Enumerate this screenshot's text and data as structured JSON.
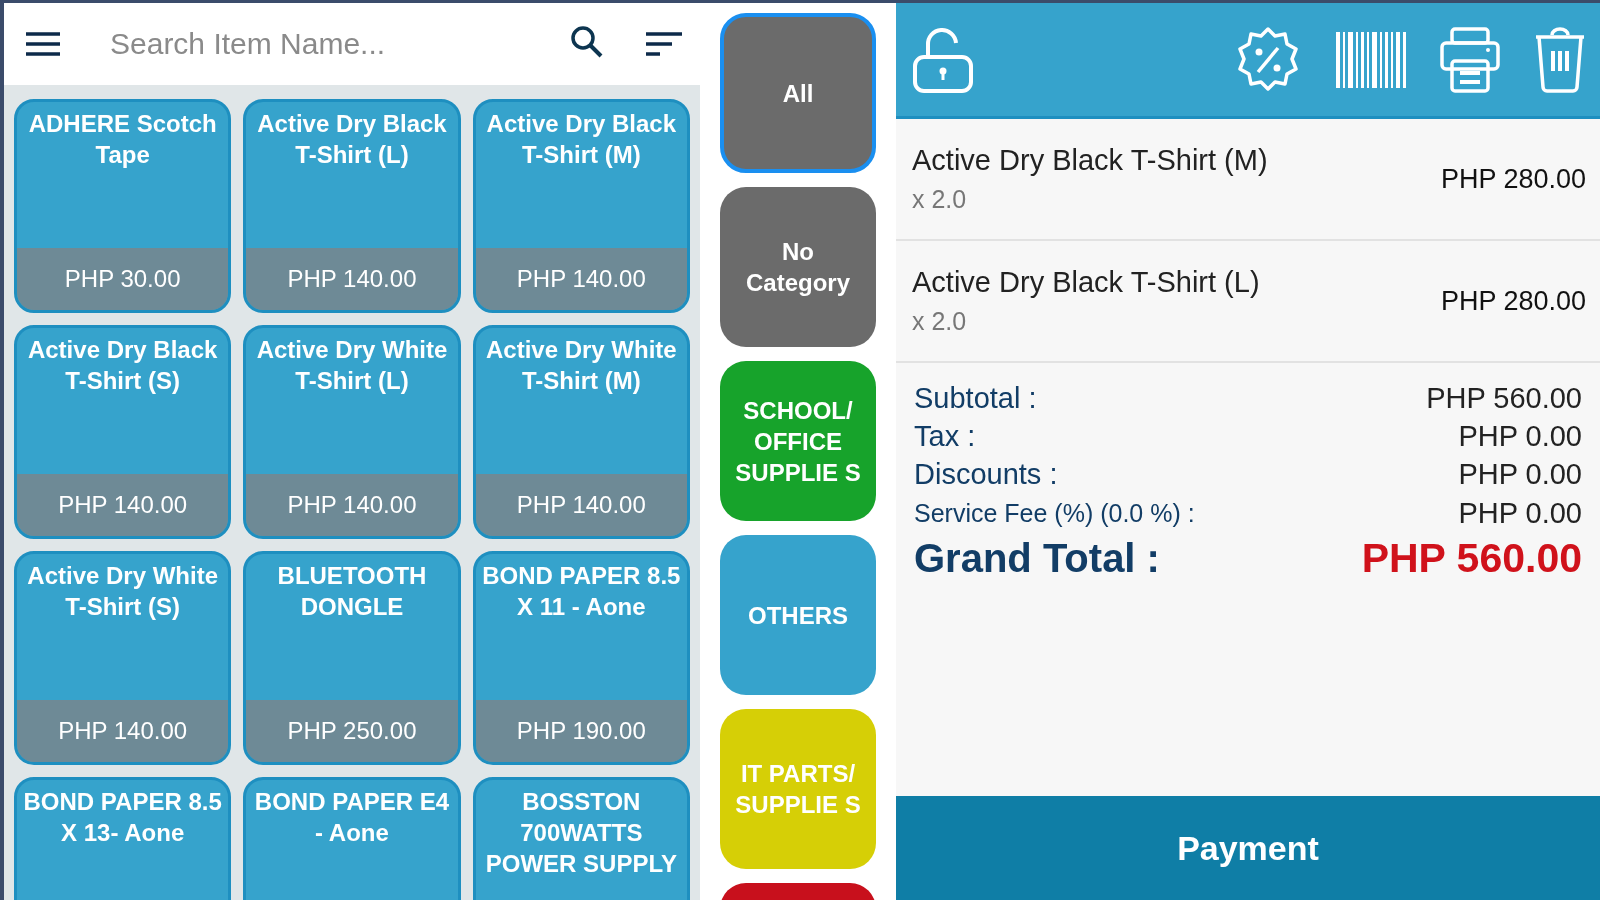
{
  "search": {
    "placeholder": "Search Item Name..."
  },
  "items": [
    {
      "name": "ADHERE Scotch Tape",
      "price": "PHP 30.00"
    },
    {
      "name": "Active Dry Black T-Shirt (L)",
      "price": "PHP 140.00"
    },
    {
      "name": "Active Dry Black T-Shirt (M)",
      "price": "PHP 140.00"
    },
    {
      "name": "Active Dry Black T-Shirt (S)",
      "price": "PHP 140.00"
    },
    {
      "name": "Active Dry White T-Shirt (L)",
      "price": "PHP 140.00"
    },
    {
      "name": "Active Dry White T-Shirt (M)",
      "price": "PHP 140.00"
    },
    {
      "name": "Active Dry White T-Shirt (S)",
      "price": "PHP 140.00"
    },
    {
      "name": "BLUETOOTH DONGLE",
      "price": "PHP 250.00"
    },
    {
      "name": "BOND PAPER 8.5 X 11 - Aone",
      "price": "PHP 190.00"
    },
    {
      "name": "BOND PAPER 8.5 X 13- Aone"
    },
    {
      "name": "BOND PAPER E4 - Aone"
    },
    {
      "name": "BOSSTON 700WATTS POWER SUPPLY"
    }
  ],
  "categories": [
    {
      "label": "All",
      "color": "#6b6b6b",
      "selected": true
    },
    {
      "label": "No Category",
      "color": "#6b6b6b",
      "selected": false
    },
    {
      "label": "SCHOOL/ OFFICE SUPPLIE S",
      "color": "#17a32b",
      "selected": false
    },
    {
      "label": "OTHERS",
      "color": "#36a3cc",
      "selected": false
    },
    {
      "label": "IT PARTS/ SUPPLIE S",
      "color": "#d6cf06",
      "selected": false
    },
    {
      "color": "#c8101c",
      "selected": false
    }
  ],
  "cart": [
    {
      "name": "Active Dry Black T-Shirt (M)",
      "qty": "x 2.0",
      "amount": "PHP 280.00"
    },
    {
      "name": "Active Dry Black T-Shirt (L)",
      "qty": "x 2.0",
      "amount": "PHP 280.00"
    }
  ],
  "totals": [
    {
      "kind": "line",
      "label": "Subtotal :",
      "value": "PHP 560.00"
    },
    {
      "kind": "line",
      "label": "Tax :",
      "value": "PHP 0.00"
    },
    {
      "kind": "line",
      "label": "Discounts :",
      "value": "PHP 0.00"
    },
    {
      "kind": "small",
      "label": "Service Fee (%) (0.0 %) :",
      "value": "PHP 0.00"
    },
    {
      "kind": "grand",
      "label": "Grand Total :",
      "value": "PHP 560.00"
    }
  ],
  "payment_button": "Payment"
}
